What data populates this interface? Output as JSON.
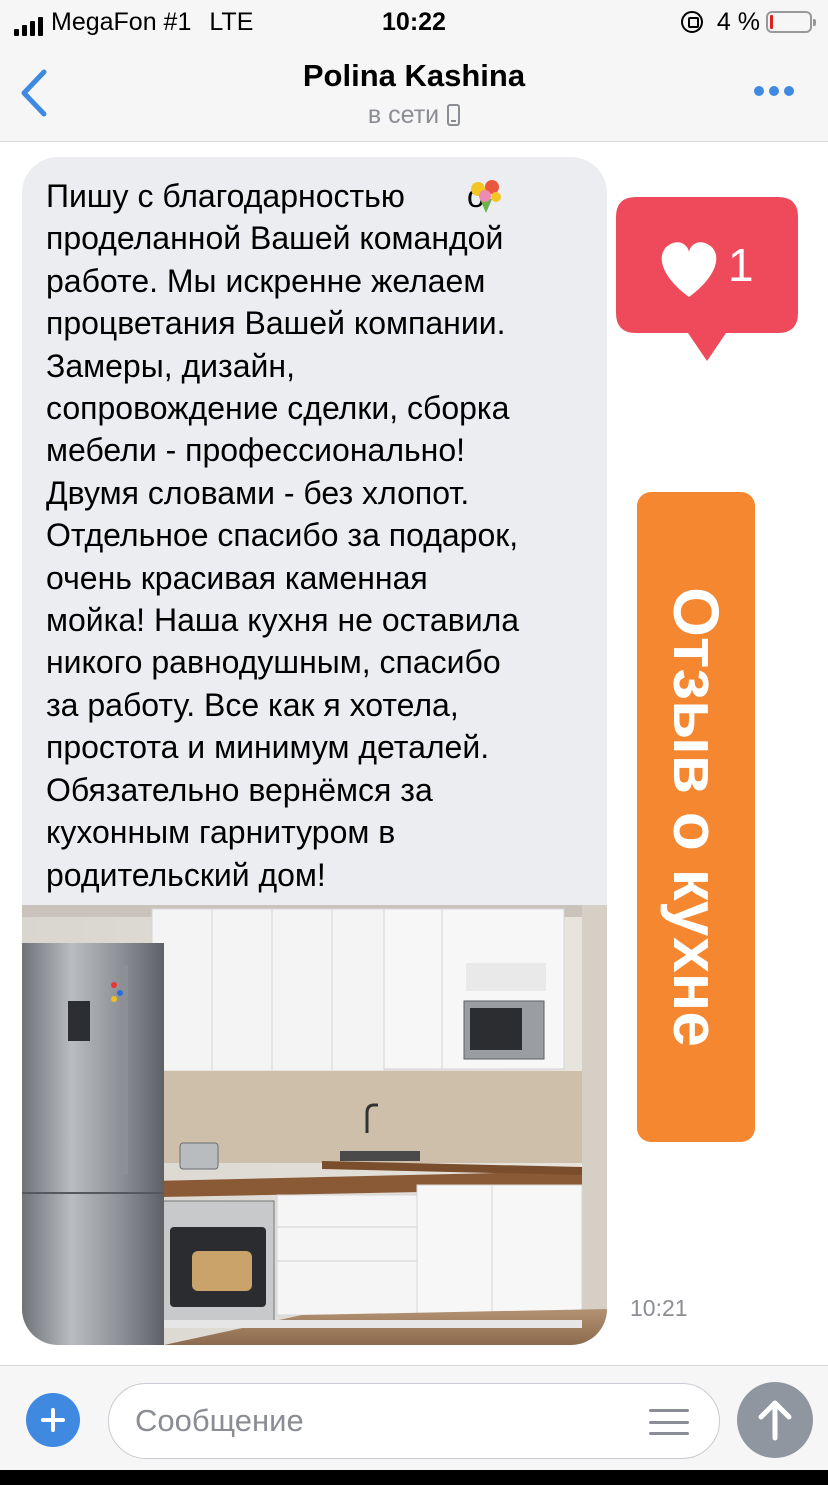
{
  "status_bar": {
    "carrier": "MegaFon #1",
    "network": "LTE",
    "time": "10:22",
    "battery": "4 %"
  },
  "header": {
    "title": "Polina Kashina",
    "subtitle": "в сети"
  },
  "message": {
    "text": "Пишу с благодарностью       о\nпроделанной Вашей командой\nработе. Мы искренне желаем\nпроцветания Вашей компании.\nЗамеры, дизайн,\nсопровождение сделки, сборка\nмебели - профессионально!\nДвумя словами - без хлопот.\nОтдельное спасибо за подарок,\nочень красивая каменная\nмойка! Наша кухня не оставила\nникого равнодушным, спасибо\nза работу. Все как я хотела,\nпростота и минимум деталей.\nОбязательно вернёмся за\nкухонным гарнитуром в\nродительский дом!",
    "time": "10:21"
  },
  "overlay": {
    "like_count": "1",
    "review_label": "Отзыв о кухне"
  },
  "input": {
    "placeholder": "Сообщение"
  },
  "colors": {
    "accent": "#3f8ae0",
    "like": "#ef4a5b",
    "review": "#f48730",
    "bubble": "#ebedf0"
  }
}
